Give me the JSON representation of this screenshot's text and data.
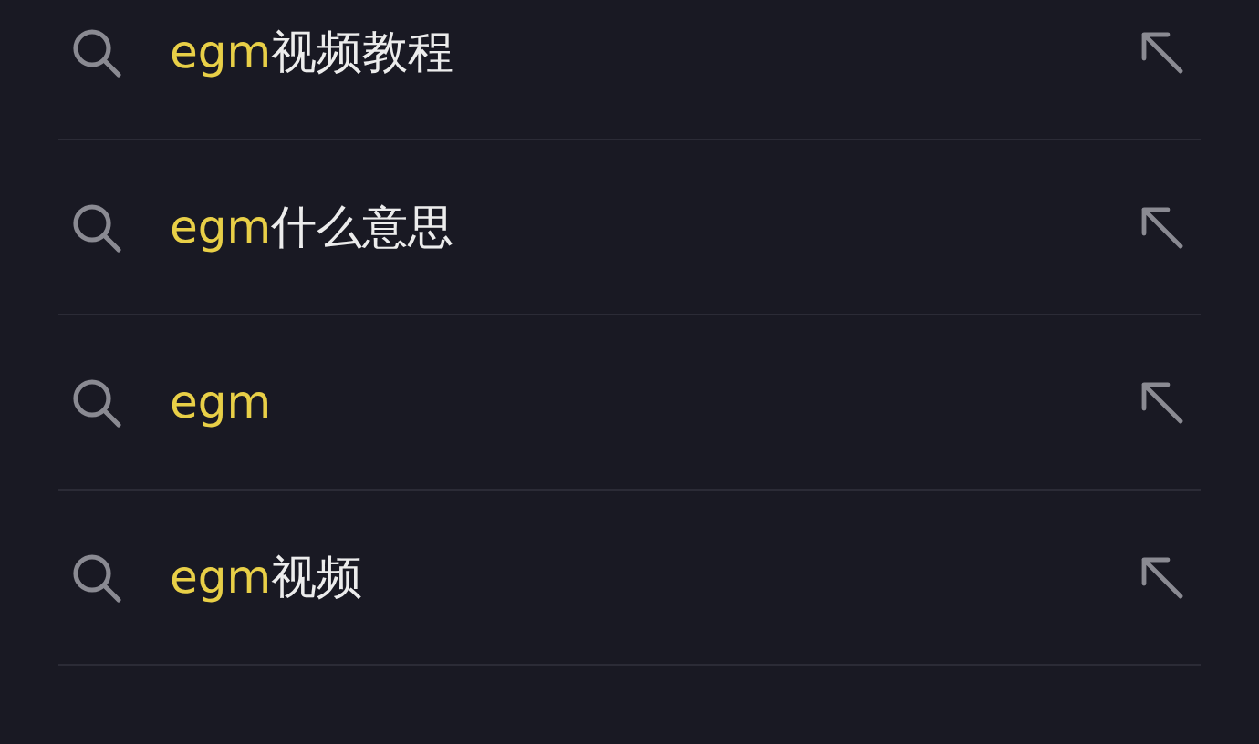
{
  "suggestions": [
    {
      "match": "egm",
      "rest": "视频教程"
    },
    {
      "match": "egm",
      "rest": "什么意思"
    },
    {
      "match": "egm"
    },
    {
      "match": "egm",
      "rest": "视频"
    }
  ]
}
